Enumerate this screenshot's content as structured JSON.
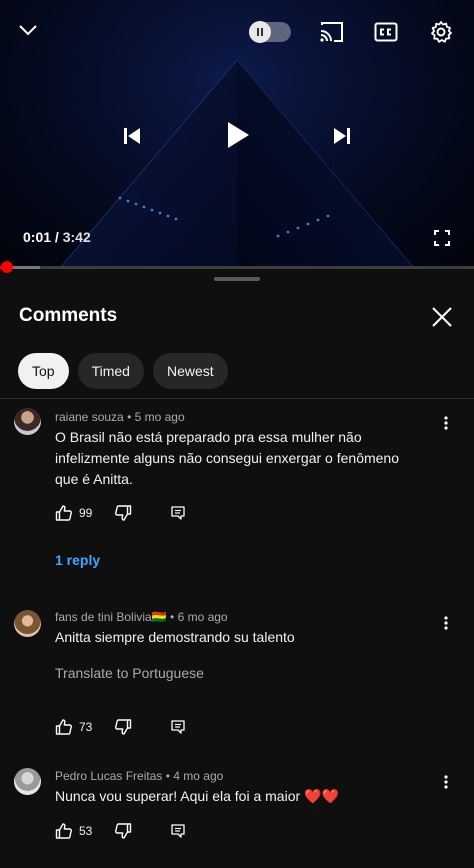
{
  "player": {
    "current_time": "0:01",
    "separator": "/",
    "duration": "3:42",
    "progress_fraction": 0.005,
    "buffer_fraction": 0.085,
    "accent_color": "#ff0000",
    "icons": [
      "chevron-down-icon",
      "pause-icon",
      "cast-icon",
      "cc-icon",
      "gear-icon",
      "previous-icon",
      "play-icon",
      "next-icon",
      "fullscreen-icon"
    ]
  },
  "panel": {
    "title": "Comments",
    "chips": [
      {
        "label": "Top",
        "active": true
      },
      {
        "label": "Timed",
        "active": false
      },
      {
        "label": "Newest",
        "active": false
      }
    ]
  },
  "comments": [
    {
      "author": "raiane souza",
      "age": "5 mo ago",
      "text": "O Brasil não está preparado pra essa mulher não infelizmente alguns não consegui enxergar o fenômeno que é Anitta.",
      "likes": "99",
      "replies_label": "1 reply"
    },
    {
      "author": "fans de tini Bolivia🇧🇴",
      "age": "6 mo ago",
      "text": "Anitta siempre demostrando su talento",
      "translate": "Translate to Portuguese",
      "likes": "73"
    },
    {
      "author": "Pedro Lucas Freitas",
      "age": "4 mo ago",
      "text": "Nunca vou superar! Aqui ela foi a maior ❤️❤️",
      "likes": "53"
    }
  ],
  "meta_separator": "•",
  "reply_link_color": "#3ea6ff"
}
